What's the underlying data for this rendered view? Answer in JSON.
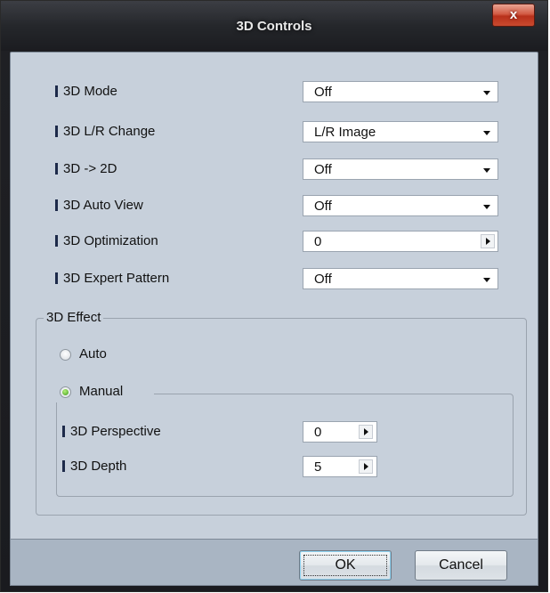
{
  "window": {
    "title": "3D Controls",
    "close_label": "x"
  },
  "settings": [
    {
      "label": "3D Mode",
      "value": "Off",
      "control": "dropdown"
    },
    {
      "label": "3D L/R Change",
      "value": "L/R Image",
      "control": "dropdown"
    },
    {
      "label": "3D -> 2D",
      "value": "Off",
      "control": "dropdown"
    },
    {
      "label": "3D Auto View",
      "value": "Off",
      "control": "dropdown"
    },
    {
      "label": "3D Optimization",
      "value": "0",
      "control": "stepper"
    },
    {
      "label": "3D Expert Pattern",
      "value": "Off",
      "control": "dropdown"
    }
  ],
  "effect": {
    "legend": "3D Effect",
    "auto_label": "Auto",
    "manual_label": "Manual",
    "selected": "Manual",
    "manual_settings": [
      {
        "label": "3D Perspective",
        "value": "0"
      },
      {
        "label": "3D Depth",
        "value": "5"
      }
    ]
  },
  "buttons": {
    "ok": "OK",
    "cancel": "Cancel"
  }
}
